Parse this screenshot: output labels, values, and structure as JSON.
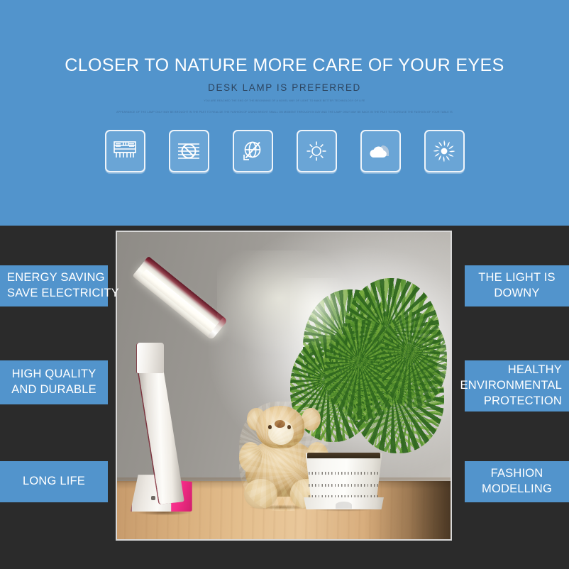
{
  "header": {
    "title": "CLOSER TO NATURE MORE CARE OF YOUR EYES",
    "subtitle": "DESK LAMP IS PREFERRED",
    "fineprint_line1": "YOU ARE REACHED THE END OF THE BEGINNING OF A NOVEL WAY OF LIGHT TO MAKE BETTER TECHNOLOGY OF LIFE",
    "fineprint_line2": "APPEARANCE OF THE LAMP ONLY MAY BE BROUGHT IN THE PAST TO REALIZE THE FASHION OF USING BRIGHT SMALL ON MOMENT THROUGH IN DAY AND THE LAMP ONLY MAY BE BACK IN THE PAST TO INCREASE THE FASHION OF YOUR TABLE IS"
  },
  "icons": [
    {
      "name": "led-panel-icon",
      "label": "LED PANEL"
    },
    {
      "name": "no-flicker-icon",
      "label": "NO FLICKER"
    },
    {
      "name": "no-radiation-icon",
      "label": "NO RADIATION"
    },
    {
      "name": "brightness-sun-icon",
      "label": "BRIGHTNESS"
    },
    {
      "name": "soft-cloud-icon",
      "label": "SOFT LIGHT"
    },
    {
      "name": "sunburst-icon",
      "label": "NATURAL LIGHT"
    }
  ],
  "features_left": [
    {
      "name": "feature-energy-saving",
      "lines": [
        "ENERGY SAVING",
        "SAVE ELECTRICITY"
      ],
      "align": "left"
    },
    {
      "name": "feature-high-quality",
      "lines": [
        "HIGH QUALITY",
        "AND DURABLE"
      ],
      "align": "center"
    },
    {
      "name": "feature-long-life",
      "lines": [
        "LONG LIFE"
      ],
      "align": "center"
    }
  ],
  "features_right": [
    {
      "name": "feature-light-downy",
      "lines": [
        "THE LIGHT IS",
        "DOWNY"
      ],
      "align": "center"
    },
    {
      "name": "feature-healthy-eco",
      "lines": [
        "HEALTHY",
        "ENVIRONMENTAL",
        "PROTECTION"
      ],
      "align": "right"
    },
    {
      "name": "feature-fashion-modelling",
      "lines": [
        "FASHION",
        "MODELLING"
      ],
      "align": "center"
    }
  ],
  "product_photo": {
    "name": "desk-lamp-product-photo",
    "alt": "Foldable LED desk lamp with pink base beside a teddy bear and a potted green plant on a wooden table",
    "subjects": [
      "led-desk-lamp",
      "teddy-bear",
      "potted-plant",
      "wooden-table"
    ]
  },
  "colors": {
    "brand_blue": "#5294cc",
    "icon_tile_blue": "#6aa5d6",
    "dark_background": "#2b2b2b",
    "label_text": "#ffffff",
    "subtitle_text": "#2d4560",
    "lamp_accent_pink": "#f22c86"
  }
}
